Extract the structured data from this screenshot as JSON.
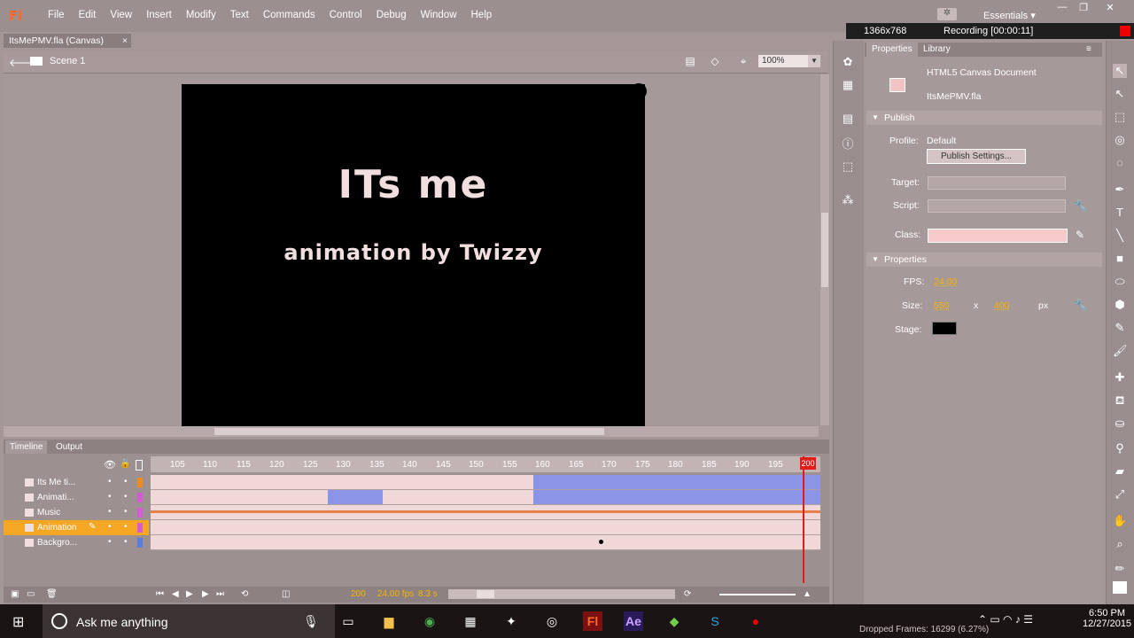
{
  "app": {
    "logo": "Fl",
    "workspace": "Essentials"
  },
  "menu": [
    "File",
    "Edit",
    "View",
    "Insert",
    "Modify",
    "Text",
    "Commands",
    "Control",
    "Debug",
    "Window",
    "Help"
  ],
  "recorder": {
    "resolution": "1366x768",
    "status": "Recording [00:00:11]"
  },
  "document_tab": {
    "label": "ItsMePMV.fla (Canvas)",
    "close": "×"
  },
  "scene": {
    "label": "Scene 1",
    "zoom": "100%"
  },
  "stage": {
    "line1": "ITs me",
    "line2": "animation by Twizzy",
    "background": "#000000"
  },
  "properties": {
    "tab_properties": "Properties",
    "tab_library": "Library",
    "doc_type": "HTML5 Canvas Document",
    "doc_name": "ItsMePMV.fla",
    "publish_section": "Publish",
    "profile_label": "Profile:",
    "profile_value": "Default",
    "publish_settings": "Publish Settings...",
    "target_label": "Target:",
    "script_label": "Script:",
    "class_label": "Class:",
    "properties_section": "Properties",
    "fps_label": "FPS:",
    "fps_value": "24.00",
    "size_label": "Size:",
    "width": "550",
    "x": "x",
    "height": "400",
    "unit": "px",
    "stage_label": "Stage:"
  },
  "timeline": {
    "tab_timeline": "Timeline",
    "tab_output": "Output",
    "ruler": [
      "105",
      "110",
      "115",
      "120",
      "125",
      "130",
      "135",
      "140",
      "145",
      "150",
      "155",
      "160",
      "165",
      "170",
      "175",
      "180",
      "185",
      "190",
      "195"
    ],
    "playhead_frame": "200",
    "layers": [
      {
        "name": "Its Me ti...",
        "color": "#f08c1c"
      },
      {
        "name": "Animati...",
        "color": "#d65ad6"
      },
      {
        "name": "Music",
        "color": "#d65ad6"
      },
      {
        "name": "Animation",
        "color": "#d65ad6"
      },
      {
        "name": "Backgro...",
        "color": "#5a7de0"
      }
    ],
    "status_frame": "200",
    "status_fps": "24.00 fps",
    "status_time": "8.3 s"
  },
  "taskbar": {
    "search": "Ask me anything",
    "time": "6:50 PM",
    "date": "12/27/2015",
    "dropped_frames": "Dropped Frames: 16299 (6.27%)"
  }
}
